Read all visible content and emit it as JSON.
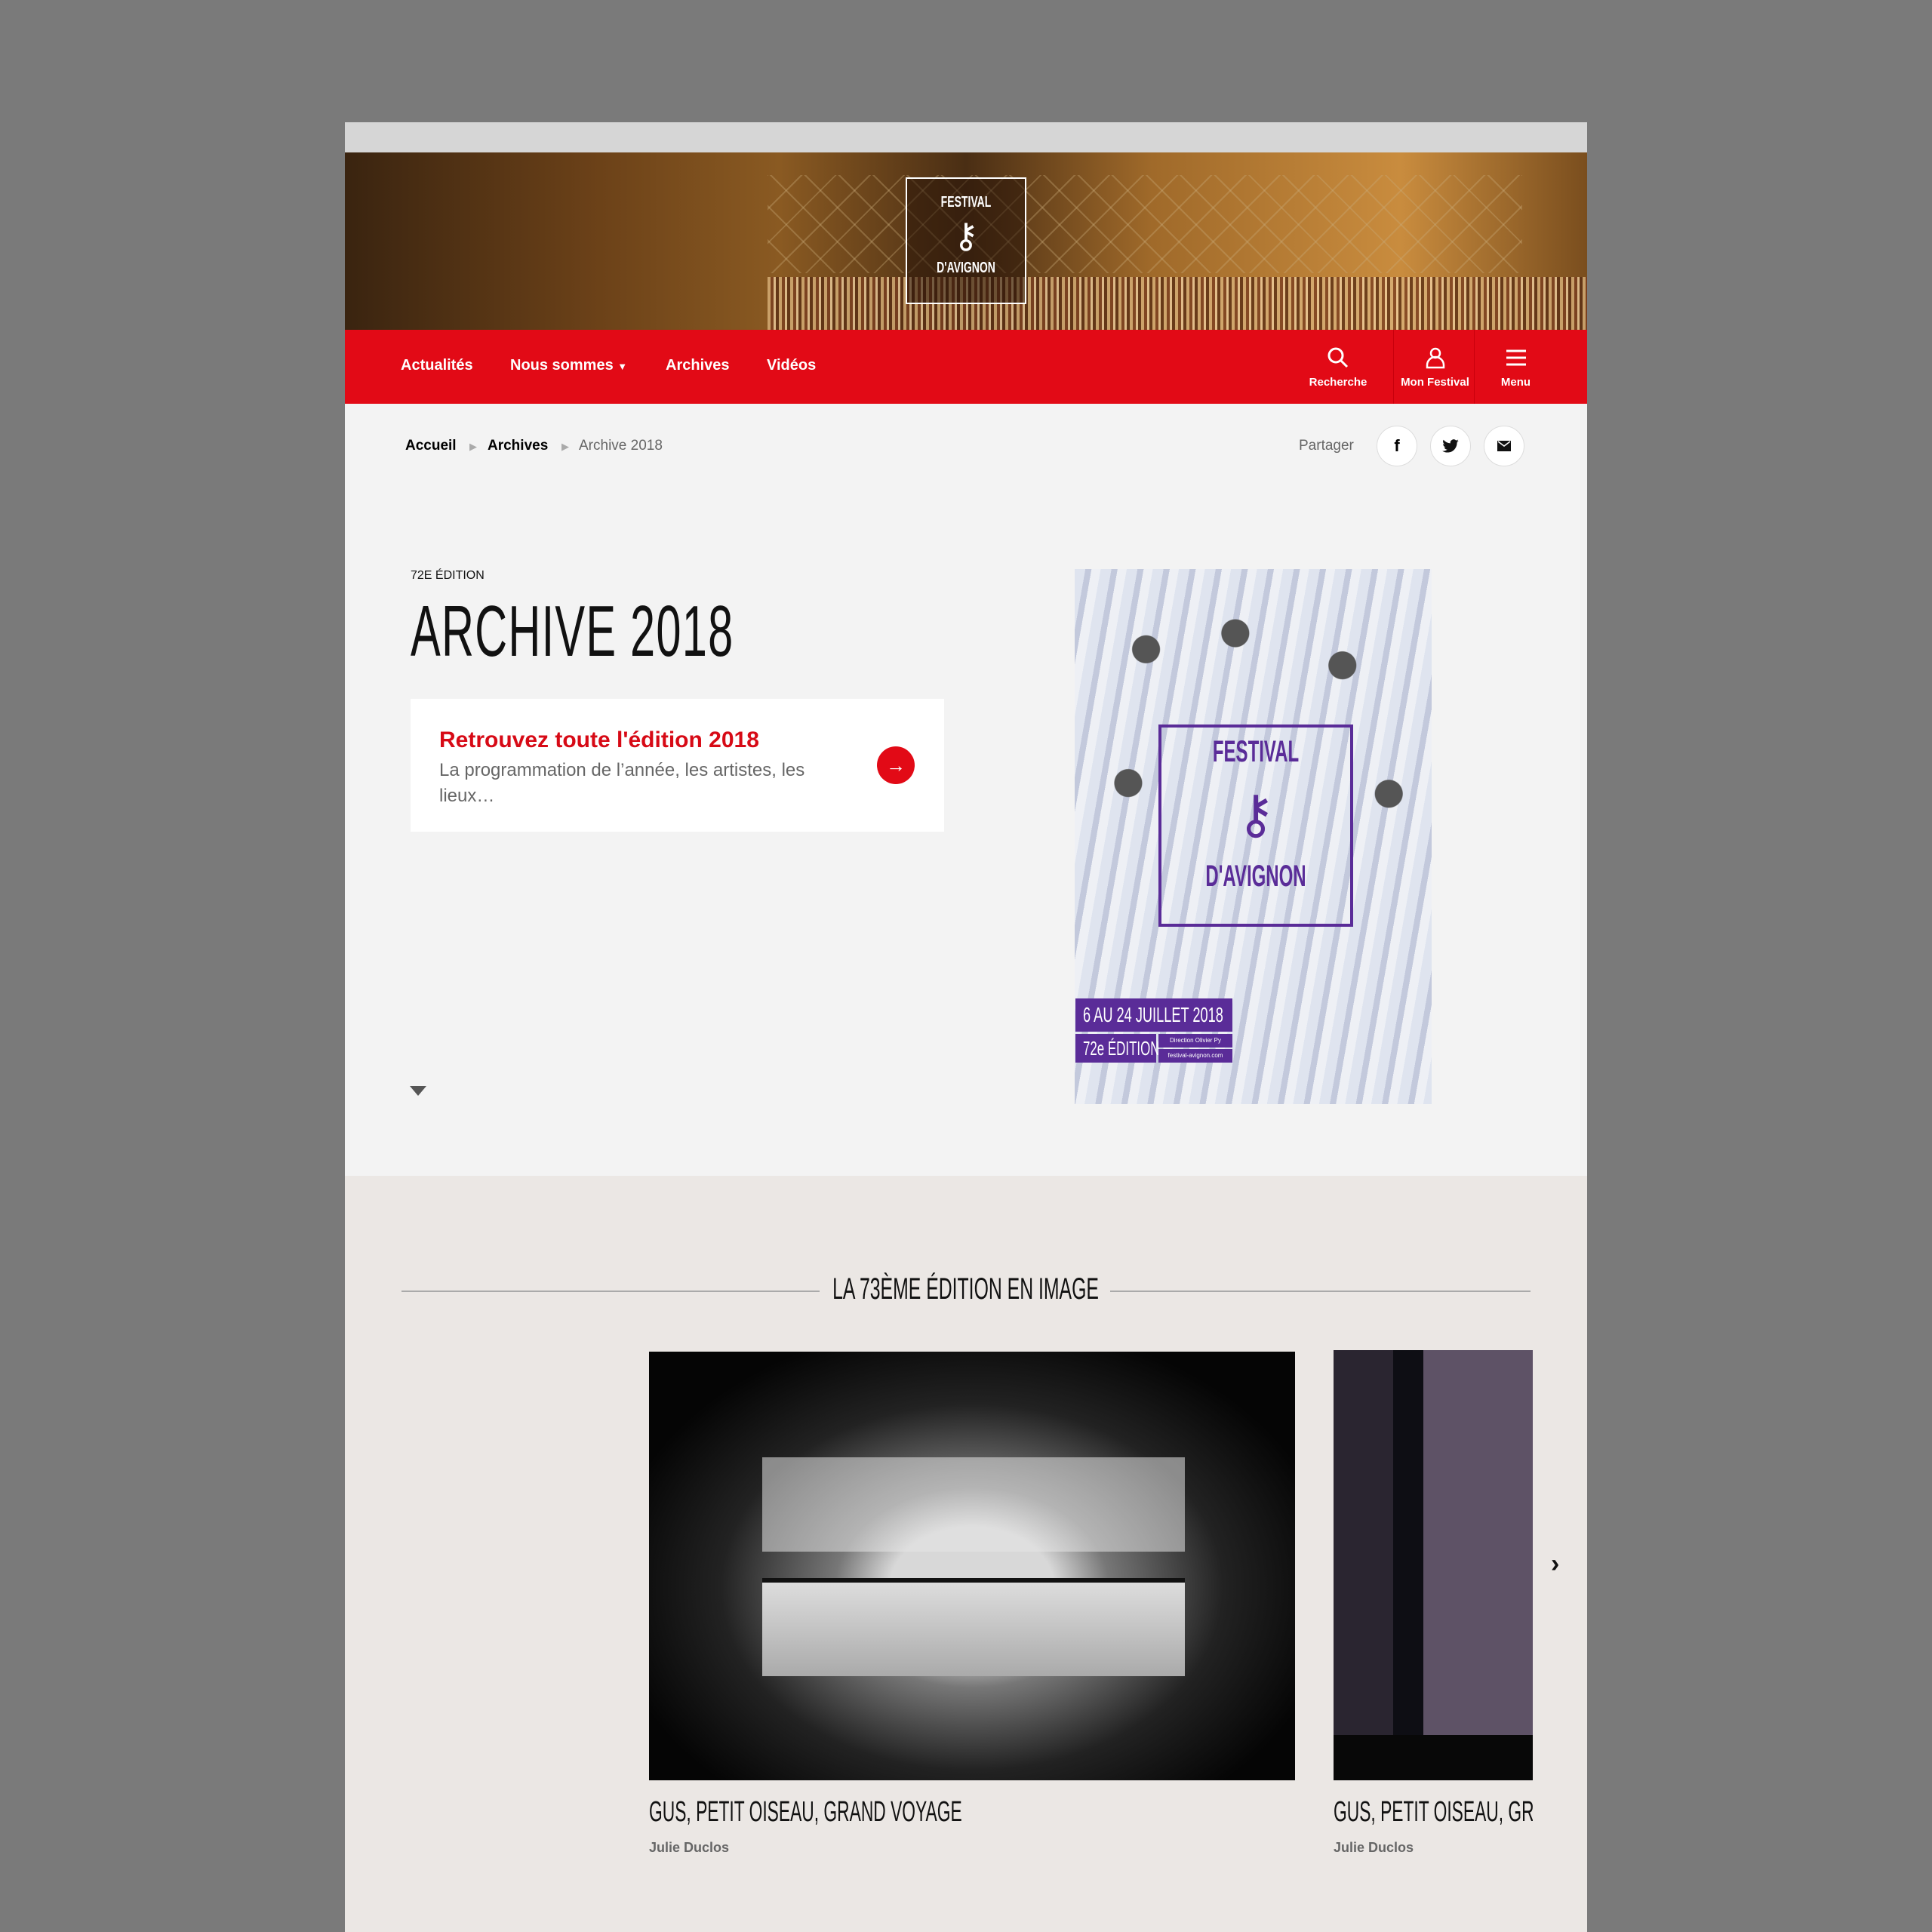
{
  "header": {
    "logo_top": "FESTIVAL",
    "logo_bottom": "D'AVIGNON"
  },
  "nav": {
    "items": [
      "Actualités",
      "Nous sommes",
      "Archives",
      "Vidéos"
    ],
    "dropdown_caret": "▼",
    "right": [
      {
        "label": "Recherche",
        "icon": "search-icon"
      },
      {
        "label": "Mon Festival",
        "icon": "user-icon"
      },
      {
        "label": "Menu",
        "icon": "hamburger-menu-icon"
      }
    ]
  },
  "breadcrumb": {
    "items": [
      "Accueil",
      "Archives",
      "Archive 2018"
    ]
  },
  "share": {
    "label": "Partager",
    "icons": [
      "facebook-icon",
      "twitter-icon",
      "mail-icon"
    ]
  },
  "hero": {
    "kicker": "72E ÉDITION",
    "title": "ARCHIVE 2018",
    "card": {
      "title": "Retrouvez toute l'édition 2018",
      "description": "La programmation de l’année, les artistes, les lieux…"
    }
  },
  "poster": {
    "top": "FESTIVAL",
    "bottom": "D'AVIGNON",
    "dates": "6 AU 24 JUILLET 2018",
    "edition": "72e ÉDITION",
    "direction": "Direction Olivier Py",
    "website": "festival-avignon.com"
  },
  "gallery": {
    "title": "LA 73ÈME ÉDITION EN IMAGE",
    "items": [
      {
        "title": "GUS, PETIT OISEAU, GRAND VOYAGE",
        "author": "Julie Duclos"
      },
      {
        "title": "GUS, PETIT OISEAU, GRAND VOYAGE",
        "author": "Julie Duclos"
      }
    ]
  },
  "colors": {
    "brand_red": "#e20a16",
    "poster_purple": "#5a2c98"
  }
}
